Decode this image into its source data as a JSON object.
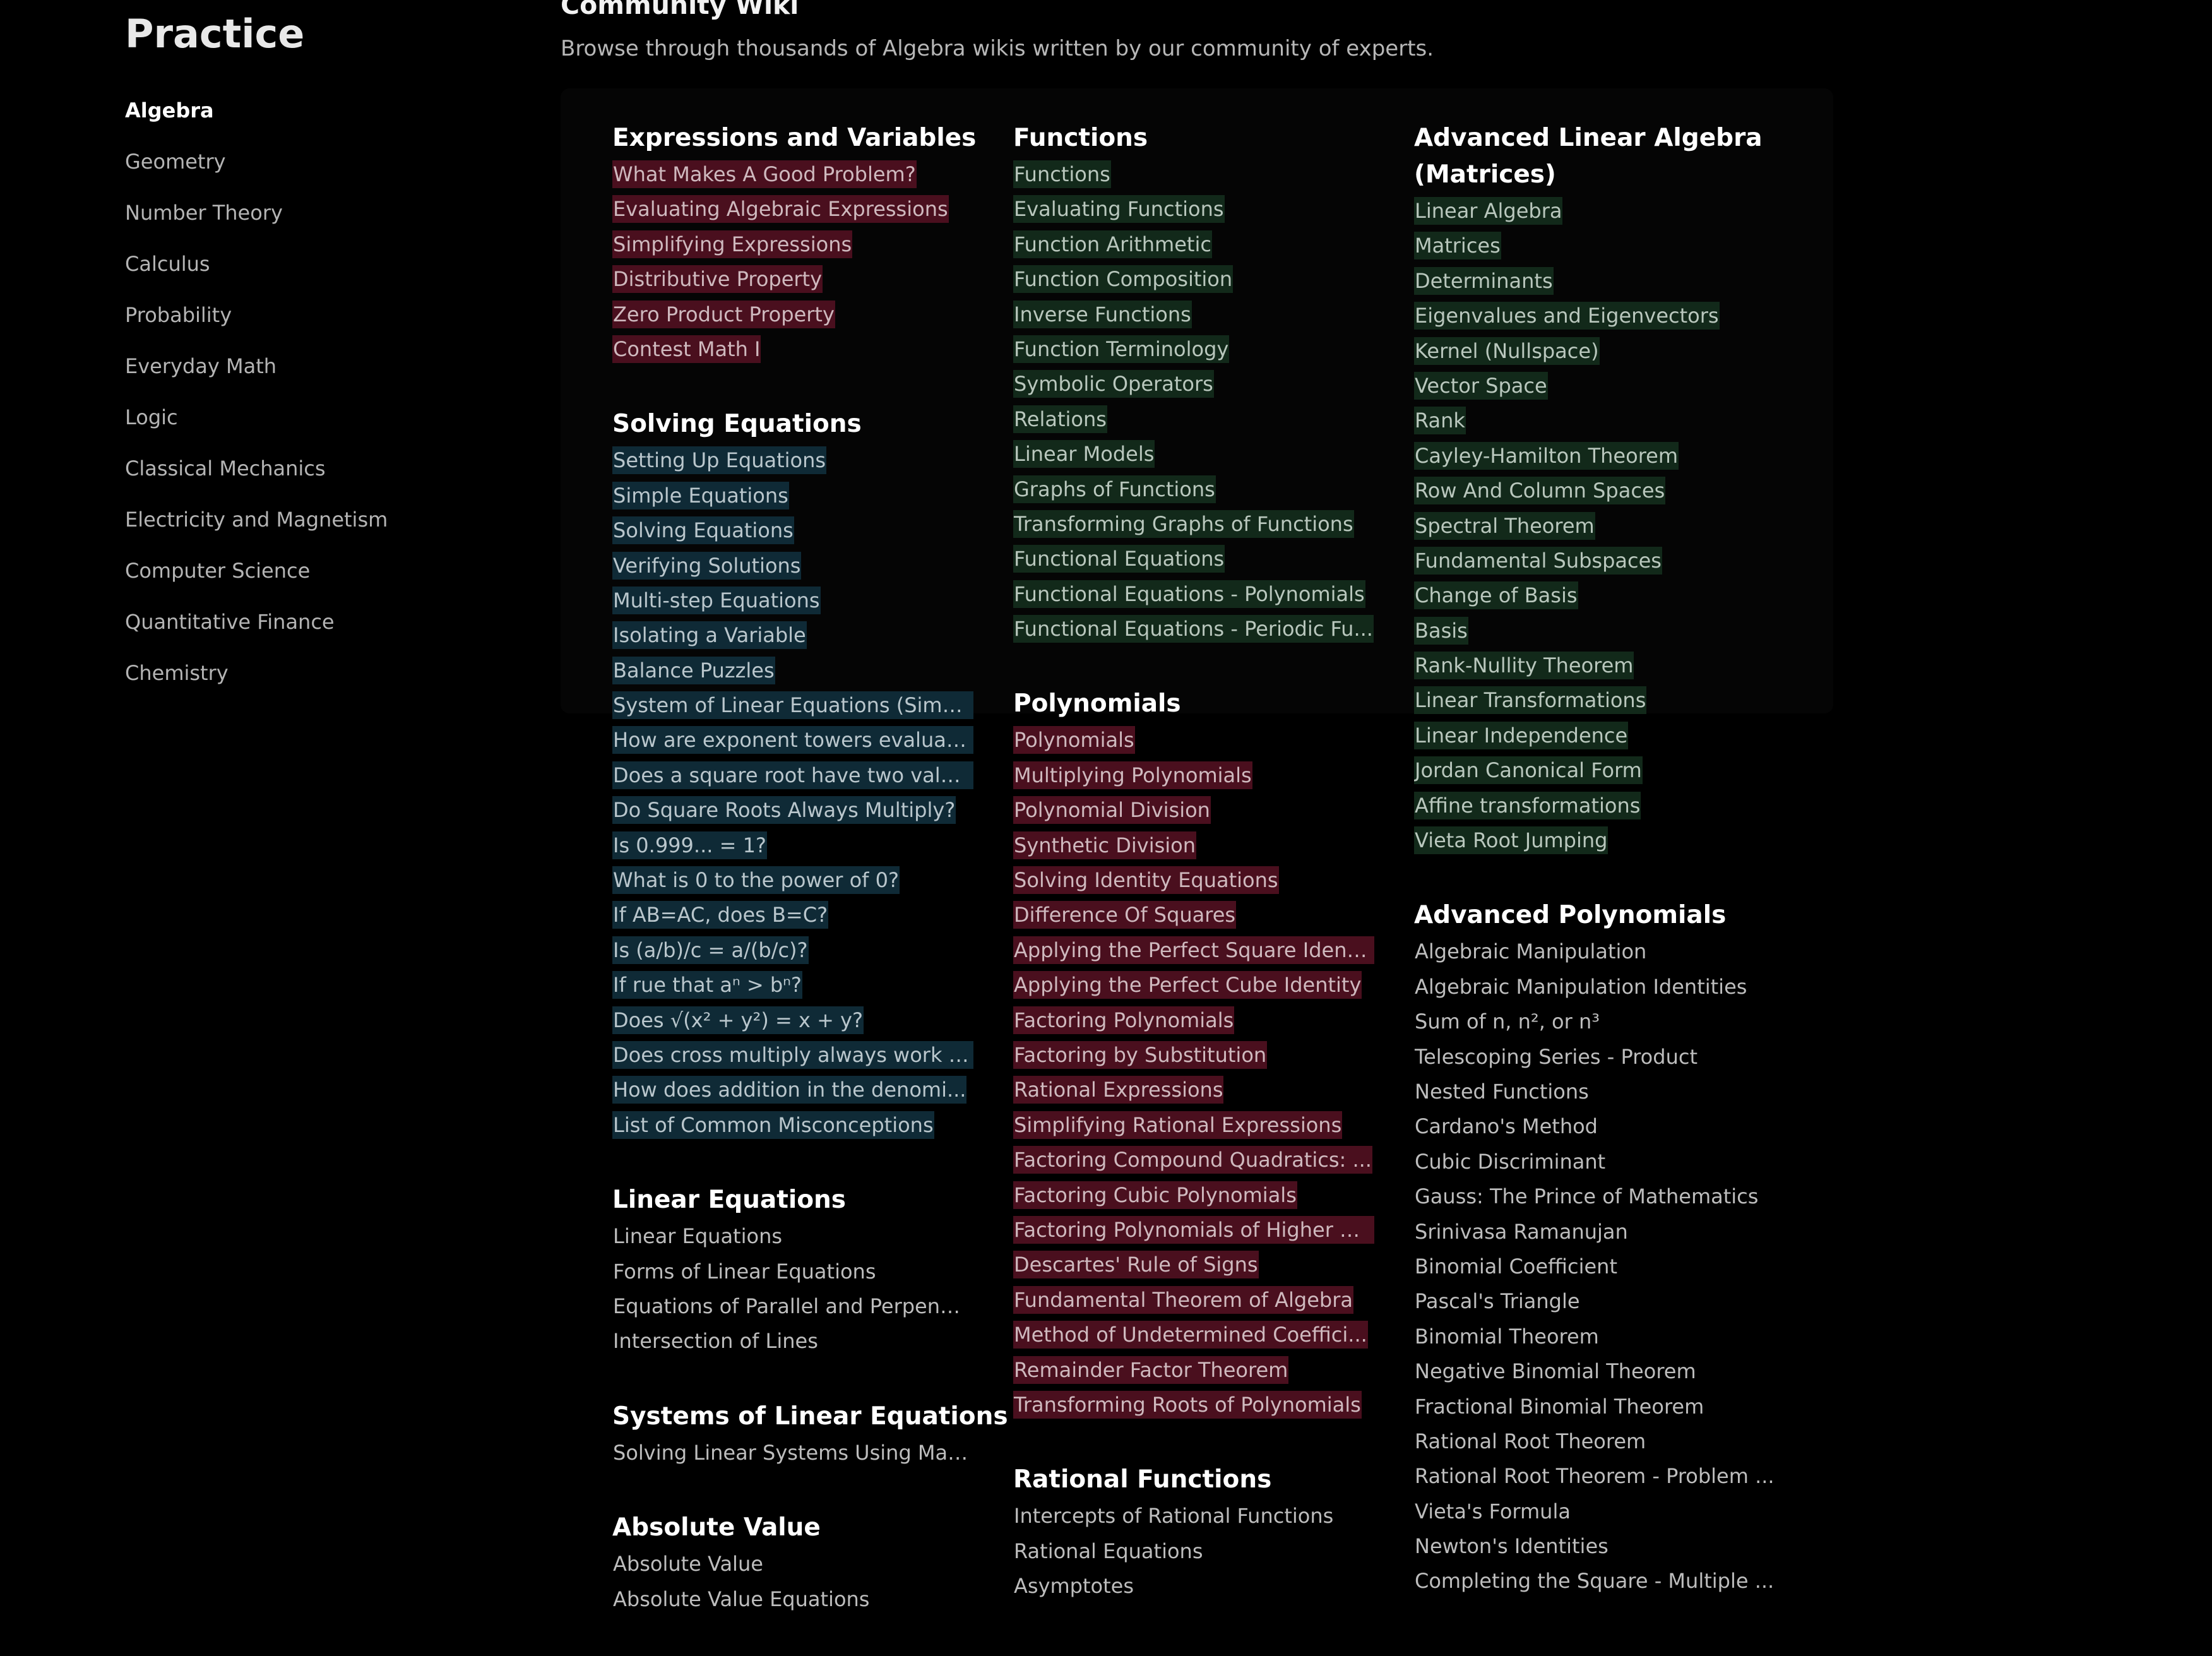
{
  "sidebar": {
    "title": "Practice",
    "items": [
      {
        "label": "Algebra"
      },
      {
        "label": "Geometry"
      },
      {
        "label": "Number Theory"
      },
      {
        "label": "Calculus"
      },
      {
        "label": "Probability"
      },
      {
        "label": "Everyday Math"
      },
      {
        "label": "Logic"
      },
      {
        "label": "Classical Mechanics"
      },
      {
        "label": "Electricity and Magnetism"
      },
      {
        "label": "Computer Science"
      },
      {
        "label": "Quantitative Finance"
      },
      {
        "label": "Chemistry"
      }
    ]
  },
  "header": {
    "title": "Community Wiki",
    "subtitle": "Browse through thousands of Algebra wikis written by our community of experts."
  },
  "colors": {
    "red_highlight": "#4a0f1e",
    "blue_highlight": "#0f2a36",
    "green_highlight": "#12291a",
    "background": "#000000"
  },
  "columns": [
    {
      "sections": [
        {
          "title": "Expressions and Variables",
          "highlight": "red",
          "items": [
            "What Makes A Good Problem?",
            "Evaluating Algebraic Expressions",
            "Simplifying Expressions",
            "Distributive Property",
            "Zero Product Property",
            "Contest Math I"
          ]
        },
        {
          "title": "Solving Equations",
          "highlight": "blue",
          "items": [
            "Setting Up Equations",
            "Simple Equations",
            "Solving Equations",
            "Verifying Solutions",
            "Multi-step Equations",
            "Isolating a Variable",
            "Balance Puzzles",
            "System of Linear Equations (Simul...",
            "How are exponent towers evaluate...",
            "Does a square root have two value...",
            "Do Square Roots Always Multiply?",
            "Is 0.999... = 1?",
            "What is 0 to the power of 0?",
            "If AB=AC, does B=C?",
            "Is (a/b)/c = a/(b/c)?",
            "If rue that aⁿ > bⁿ?",
            "Does √(x² + y²) = x + y?",
            "Does cross multiply always work fo...",
            "How does addition in the denomi...",
            "List of Common Misconceptions"
          ]
        },
        {
          "title": "Linear Equations",
          "highlight": "plain",
          "items": [
            "Linear Equations",
            "Forms of Linear Equations",
            "Equations of Parallel and Perpendi...",
            "Intersection of Lines"
          ]
        },
        {
          "title": "Systems of Linear Equations",
          "highlight": "plain",
          "items": [
            "Solving Linear Systems Using Mat..."
          ]
        },
        {
          "title": "Absolute Value",
          "highlight": "plain",
          "items": [
            "Absolute Value",
            "Absolute Value Equations"
          ]
        }
      ]
    },
    {
      "sections": [
        {
          "title": "Functions",
          "highlight": "green",
          "items": [
            "Functions",
            "Evaluating Functions",
            "Function Arithmetic",
            "Function Composition",
            "Inverse Functions",
            "Function Terminology",
            "Symbolic Operators",
            "Relations",
            "Linear Models",
            "Graphs of Functions",
            "Transforming Graphs of Functions",
            "Functional Equations",
            "Functional Equations - Polynomials",
            "Functional Equations - Periodic Fu..."
          ]
        },
        {
          "title": "Polynomials",
          "highlight": "red",
          "items": [
            "Polynomials",
            "Multiplying Polynomials",
            "Polynomial Division",
            "Synthetic Division",
            "Solving Identity Equations",
            "Difference Of Squares",
            "Applying the Perfect Square Identi...",
            "Applying the Perfect Cube Identity",
            "Factoring Polynomials",
            "Factoring by Substitution",
            "Rational Expressions",
            "Simplifying Rational Expressions",
            "Factoring Compound Quadratics: ...",
            "Factoring Cubic Polynomials",
            "Factoring Polynomials of Higher D...",
            "Descartes' Rule of Signs",
            "Fundamental Theorem of Algebra",
            "Method of Undetermined Coeffici...",
            "Remainder Factor Theorem",
            "Transforming Roots of Polynomials"
          ]
        },
        {
          "title": "Rational Functions",
          "highlight": "plain",
          "items": [
            "Intercepts of Rational Functions",
            "Rational Equations",
            "Asymptotes"
          ]
        }
      ]
    },
    {
      "sections": [
        {
          "title": "Advanced Linear Algebra (Matrices)",
          "highlight": "green",
          "items": [
            "Linear Algebra",
            "Matrices",
            "Determinants",
            "Eigenvalues and Eigenvectors",
            "Kernel (Nullspace)",
            "Vector Space",
            "Rank",
            "Cayley-Hamilton Theorem",
            "Row And Column Spaces",
            "Spectral Theorem",
            "Fundamental Subspaces",
            "Change of Basis",
            "Basis",
            "Rank-Nullity Theorem",
            "Linear Transformations",
            "Linear Independence",
            "Jordan Canonical Form",
            "Affine transformations",
            "Vieta Root Jumping"
          ]
        },
        {
          "title": "Advanced Polynomials",
          "highlight": "plain",
          "items": [
            "Algebraic Manipulation",
            "Algebraic Manipulation Identities",
            "Sum of n, n², or n³",
            "Telescoping Series - Product",
            "Nested Functions",
            "Cardano's Method",
            "Cubic Discriminant",
            "Gauss: The Prince of Mathematics",
            "Srinivasa Ramanujan",
            "Binomial Coefficient",
            "Pascal's Triangle",
            "Binomial Theorem",
            "Negative Binomial Theorem",
            "Fractional Binomial Theorem",
            "Rational Root Theorem",
            "Rational Root Theorem - Problem ...",
            "Vieta's Formula",
            "Newton's Identities",
            "Completing the Square - Multiple ..."
          ]
        }
      ]
    }
  ]
}
